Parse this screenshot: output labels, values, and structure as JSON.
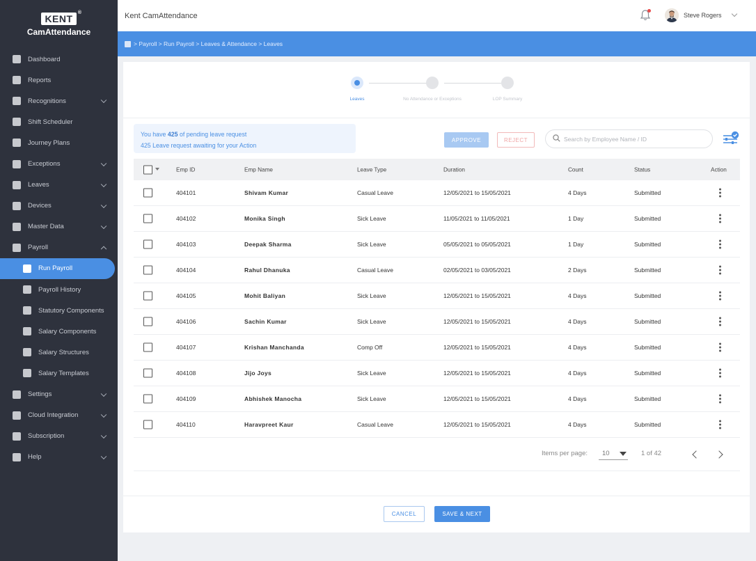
{
  "brand": {
    "logo_text": "KENT",
    "registered": "®",
    "name": "CamAttendance"
  },
  "sidebar": {
    "items": [
      {
        "label": "Dashboard",
        "chevron": false
      },
      {
        "label": "Reports",
        "chevron": false
      },
      {
        "label": "Recognitions",
        "chevron": true
      },
      {
        "label": "Shift Scheduler",
        "chevron": false
      },
      {
        "label": "Journey Plans",
        "chevron": false
      },
      {
        "label": "Exceptions",
        "chevron": true
      },
      {
        "label": "Leaves",
        "chevron": true
      },
      {
        "label": "Devices",
        "chevron": true
      },
      {
        "label": "Master Data",
        "chevron": true
      },
      {
        "label": "Payroll",
        "chevron": "up"
      },
      {
        "label": "Run Payroll",
        "sub": true,
        "active": true
      },
      {
        "label": "Payroll History",
        "sub": true
      },
      {
        "label": "Statutory Components",
        "sub": true
      },
      {
        "label": "Salary Components",
        "sub": true
      },
      {
        "label": "Salary Structures",
        "sub": true
      },
      {
        "label": "Salary Templates",
        "sub": true
      },
      {
        "label": "Settings",
        "chevron": true
      },
      {
        "label": "Cloud Integration",
        "chevron": true
      },
      {
        "label": "Subscription",
        "chevron": true
      },
      {
        "label": "Help",
        "chevron": true
      }
    ]
  },
  "header": {
    "title": "Kent CamAttendance",
    "user_name": "Steve Rogers"
  },
  "breadcrumb": {
    "text": "> Payroll > Run Payroll > Leaves & Attendance > Leaves"
  },
  "stepper": {
    "steps": [
      {
        "label": "Leaves",
        "active": true
      },
      {
        "label": "No Attendance or Exceptions",
        "active": false
      },
      {
        "label": "LOP Summary",
        "active": false
      }
    ]
  },
  "info": {
    "line1_prefix": "You have ",
    "pending_count": "425",
    "line1_suffix": " of pending leave request",
    "line2": "425 Leave request awaiting for your Action"
  },
  "actions": {
    "approve": "APPROVE",
    "reject": "REJECT"
  },
  "search": {
    "placeholder": "Search by Employee Name / ID",
    "value": ""
  },
  "table": {
    "headers": {
      "emp_id": "Emp ID",
      "emp_name": "Emp Name",
      "leave_type": "Leave Type",
      "duration": "Duration",
      "count": "Count",
      "status": "Status",
      "action": "Action"
    },
    "rows": [
      {
        "emp_id": "404101",
        "emp_name": "Shivam Kumar",
        "leave_type": "Casual Leave",
        "duration": "12/05/2021 to 15/05/2021",
        "count": "4 Days",
        "status": "Submitted"
      },
      {
        "emp_id": "404102",
        "emp_name": "Monika Singh",
        "leave_type": "Sick Leave",
        "duration": "11/05/2021 to 11/05/2021",
        "count": "1 Day",
        "status": "Submitted"
      },
      {
        "emp_id": "404103",
        "emp_name": "Deepak Sharma",
        "leave_type": "Sick Leave",
        "duration": "05/05/2021 to 05/05/2021",
        "count": "1 Day",
        "status": "Submitted"
      },
      {
        "emp_id": "404104",
        "emp_name": "Rahul Dhanuka",
        "leave_type": "Casual Leave",
        "duration": "02/05/2021 to 03/05/2021",
        "count": "2 Days",
        "status": "Submitted"
      },
      {
        "emp_id": "404105",
        "emp_name": "Mohit Baliyan",
        "leave_type": "Sick Leave",
        "duration": "12/05/2021 to 15/05/2021",
        "count": "4 Days",
        "status": "Submitted"
      },
      {
        "emp_id": "404106",
        "emp_name": "Sachin Kumar",
        "leave_type": "Sick Leave",
        "duration": "12/05/2021 to 15/05/2021",
        "count": "4 Days",
        "status": "Submitted"
      },
      {
        "emp_id": "404107",
        "emp_name": "Krishan Manchanda",
        "leave_type": "Comp Off",
        "duration": "12/05/2021 to 15/05/2021",
        "count": "4 Days",
        "status": "Submitted"
      },
      {
        "emp_id": "404108",
        "emp_name": "Jijo Joys",
        "leave_type": "Sick Leave",
        "duration": "12/05/2021 to 15/05/2021",
        "count": "4 Days",
        "status": "Submitted"
      },
      {
        "emp_id": "404109",
        "emp_name": "Abhishek Manocha",
        "leave_type": "Sick Leave",
        "duration": "12/05/2021 to 15/05/2021",
        "count": "4 Days",
        "status": "Submitted"
      },
      {
        "emp_id": "404110",
        "emp_name": "Haravpreet Kaur",
        "leave_type": "Casual Leave",
        "duration": "12/05/2021 to 15/05/2021",
        "count": "4 Days",
        "status": "Submitted"
      }
    ]
  },
  "pagination": {
    "items_per_page_label": "Items per page:",
    "items_per_page": "10",
    "range": "1 of 42"
  },
  "footer": {
    "cancel": "CANCEL",
    "save_next": "SAVE & NEXT"
  },
  "colors": {
    "accent": "#4a8fe3",
    "sidebar_bg": "#2e323d",
    "approve_bg": "#a8c9f2",
    "reject_border": "#f2b9b9",
    "notification_dot": "#e84a4a"
  },
  "icons": {
    "notification": "bell-icon",
    "search": "search-icon",
    "filter": "filter-settings-icon",
    "row_action": "kebab-menu-icon"
  }
}
